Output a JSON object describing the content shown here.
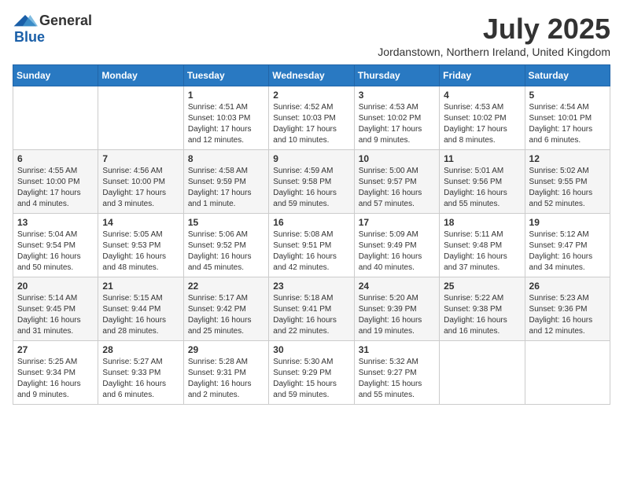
{
  "logo": {
    "general": "General",
    "blue": "Blue"
  },
  "title": "July 2025",
  "location": "Jordanstown, Northern Ireland, United Kingdom",
  "days_of_week": [
    "Sunday",
    "Monday",
    "Tuesday",
    "Wednesday",
    "Thursday",
    "Friday",
    "Saturday"
  ],
  "weeks": [
    [
      {
        "day": "",
        "info": ""
      },
      {
        "day": "",
        "info": ""
      },
      {
        "day": "1",
        "info": "Sunrise: 4:51 AM\nSunset: 10:03 PM\nDaylight: 17 hours and 12 minutes."
      },
      {
        "day": "2",
        "info": "Sunrise: 4:52 AM\nSunset: 10:03 PM\nDaylight: 17 hours and 10 minutes."
      },
      {
        "day": "3",
        "info": "Sunrise: 4:53 AM\nSunset: 10:02 PM\nDaylight: 17 hours and 9 minutes."
      },
      {
        "day": "4",
        "info": "Sunrise: 4:53 AM\nSunset: 10:02 PM\nDaylight: 17 hours and 8 minutes."
      },
      {
        "day": "5",
        "info": "Sunrise: 4:54 AM\nSunset: 10:01 PM\nDaylight: 17 hours and 6 minutes."
      }
    ],
    [
      {
        "day": "6",
        "info": "Sunrise: 4:55 AM\nSunset: 10:00 PM\nDaylight: 17 hours and 4 minutes."
      },
      {
        "day": "7",
        "info": "Sunrise: 4:56 AM\nSunset: 10:00 PM\nDaylight: 17 hours and 3 minutes."
      },
      {
        "day": "8",
        "info": "Sunrise: 4:58 AM\nSunset: 9:59 PM\nDaylight: 17 hours and 1 minute."
      },
      {
        "day": "9",
        "info": "Sunrise: 4:59 AM\nSunset: 9:58 PM\nDaylight: 16 hours and 59 minutes."
      },
      {
        "day": "10",
        "info": "Sunrise: 5:00 AM\nSunset: 9:57 PM\nDaylight: 16 hours and 57 minutes."
      },
      {
        "day": "11",
        "info": "Sunrise: 5:01 AM\nSunset: 9:56 PM\nDaylight: 16 hours and 55 minutes."
      },
      {
        "day": "12",
        "info": "Sunrise: 5:02 AM\nSunset: 9:55 PM\nDaylight: 16 hours and 52 minutes."
      }
    ],
    [
      {
        "day": "13",
        "info": "Sunrise: 5:04 AM\nSunset: 9:54 PM\nDaylight: 16 hours and 50 minutes."
      },
      {
        "day": "14",
        "info": "Sunrise: 5:05 AM\nSunset: 9:53 PM\nDaylight: 16 hours and 48 minutes."
      },
      {
        "day": "15",
        "info": "Sunrise: 5:06 AM\nSunset: 9:52 PM\nDaylight: 16 hours and 45 minutes."
      },
      {
        "day": "16",
        "info": "Sunrise: 5:08 AM\nSunset: 9:51 PM\nDaylight: 16 hours and 42 minutes."
      },
      {
        "day": "17",
        "info": "Sunrise: 5:09 AM\nSunset: 9:49 PM\nDaylight: 16 hours and 40 minutes."
      },
      {
        "day": "18",
        "info": "Sunrise: 5:11 AM\nSunset: 9:48 PM\nDaylight: 16 hours and 37 minutes."
      },
      {
        "day": "19",
        "info": "Sunrise: 5:12 AM\nSunset: 9:47 PM\nDaylight: 16 hours and 34 minutes."
      }
    ],
    [
      {
        "day": "20",
        "info": "Sunrise: 5:14 AM\nSunset: 9:45 PM\nDaylight: 16 hours and 31 minutes."
      },
      {
        "day": "21",
        "info": "Sunrise: 5:15 AM\nSunset: 9:44 PM\nDaylight: 16 hours and 28 minutes."
      },
      {
        "day": "22",
        "info": "Sunrise: 5:17 AM\nSunset: 9:42 PM\nDaylight: 16 hours and 25 minutes."
      },
      {
        "day": "23",
        "info": "Sunrise: 5:18 AM\nSunset: 9:41 PM\nDaylight: 16 hours and 22 minutes."
      },
      {
        "day": "24",
        "info": "Sunrise: 5:20 AM\nSunset: 9:39 PM\nDaylight: 16 hours and 19 minutes."
      },
      {
        "day": "25",
        "info": "Sunrise: 5:22 AM\nSunset: 9:38 PM\nDaylight: 16 hours and 16 minutes."
      },
      {
        "day": "26",
        "info": "Sunrise: 5:23 AM\nSunset: 9:36 PM\nDaylight: 16 hours and 12 minutes."
      }
    ],
    [
      {
        "day": "27",
        "info": "Sunrise: 5:25 AM\nSunset: 9:34 PM\nDaylight: 16 hours and 9 minutes."
      },
      {
        "day": "28",
        "info": "Sunrise: 5:27 AM\nSunset: 9:33 PM\nDaylight: 16 hours and 6 minutes."
      },
      {
        "day": "29",
        "info": "Sunrise: 5:28 AM\nSunset: 9:31 PM\nDaylight: 16 hours and 2 minutes."
      },
      {
        "day": "30",
        "info": "Sunrise: 5:30 AM\nSunset: 9:29 PM\nDaylight: 15 hours and 59 minutes."
      },
      {
        "day": "31",
        "info": "Sunrise: 5:32 AM\nSunset: 9:27 PM\nDaylight: 15 hours and 55 minutes."
      },
      {
        "day": "",
        "info": ""
      },
      {
        "day": "",
        "info": ""
      }
    ]
  ]
}
